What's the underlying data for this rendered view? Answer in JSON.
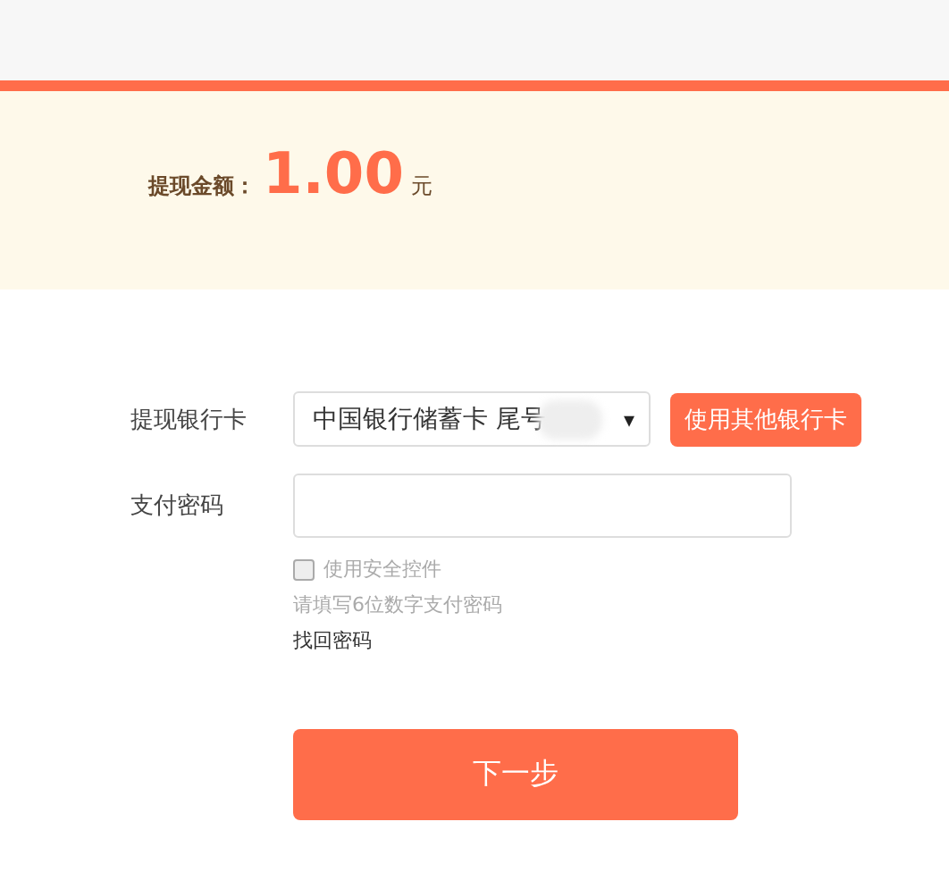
{
  "amount": {
    "label": "提现金额：",
    "value": "1.00",
    "unit": "元"
  },
  "bank_card": {
    "label": "提现银行卡",
    "value": "中国银行储蓄卡 尾号",
    "caret": "▾",
    "other_button": "使用其他银行卡"
  },
  "password": {
    "label": "支付密码",
    "security_control": {
      "label": "使用安全控件",
      "checked": false
    },
    "hint": "请填写6位数字支付密码",
    "forgot_link": "找回密码"
  },
  "submit": "下一步"
}
